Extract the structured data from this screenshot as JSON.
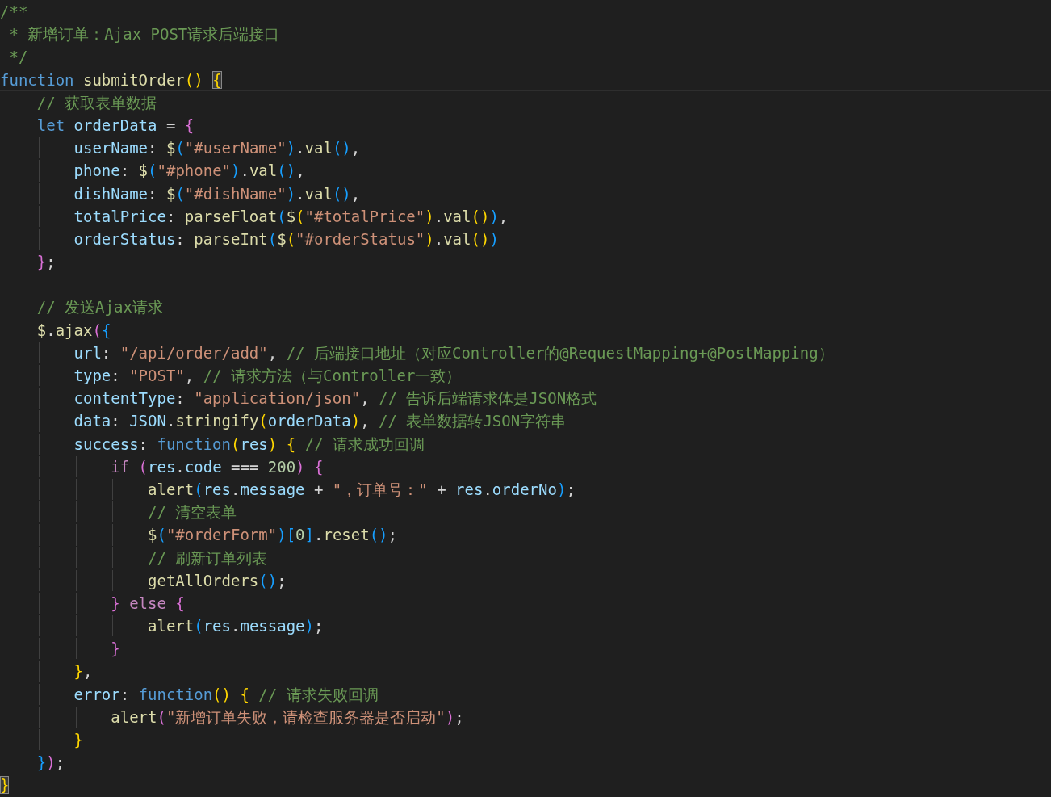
{
  "editor": {
    "lines": [
      {
        "current": false,
        "tokens": [
          {
            "text": "/**",
            "kind": "comment"
          }
        ]
      },
      {
        "current": false,
        "tokens": [
          {
            "text": " * 新增订单：Ajax POST请求后端接口",
            "kind": "comment"
          }
        ]
      },
      {
        "current": false,
        "tokens": [
          {
            "text": " */",
            "kind": "comment"
          }
        ]
      },
      {
        "current": true,
        "tokens": [
          {
            "text": "function ",
            "kind": "keyword"
          },
          {
            "text": "submitOrder",
            "kind": "function"
          },
          {
            "text": "() ",
            "kind": "bracket1"
          },
          {
            "text": "{",
            "kind": "bracket1",
            "match": true
          }
        ],
        "children": [
          {
            "current": false,
            "tokens": [
              {
                "text": "// 获取表单数据",
                "kind": "comment"
              }
            ]
          },
          {
            "current": false,
            "tokens": [
              {
                "text": "let ",
                "kind": "keyword"
              },
              {
                "text": "orderData",
                "kind": "variable"
              },
              {
                "text": " = ",
                "kind": "punctuation"
              },
              {
                "text": "{",
                "kind": "bracket2"
              }
            ],
            "children": [
              {
                "current": false,
                "tokens": [
                  {
                    "text": "userName",
                    "kind": "variable"
                  },
                  {
                    "text": ": ",
                    "kind": "punctuation"
                  },
                  {
                    "text": "$",
                    "kind": "function"
                  },
                  {
                    "text": "(",
                    "kind": "bracket3"
                  },
                  {
                    "text": "\"#userName\"",
                    "kind": "string"
                  },
                  {
                    "text": ")",
                    "kind": "bracket3"
                  },
                  {
                    "text": ".",
                    "kind": "punctuation"
                  },
                  {
                    "text": "val",
                    "kind": "function"
                  },
                  {
                    "text": "()",
                    "kind": "bracket3"
                  },
                  {
                    "text": ",",
                    "kind": "punctuation"
                  }
                ]
              },
              {
                "current": false,
                "tokens": [
                  {
                    "text": "phone",
                    "kind": "variable"
                  },
                  {
                    "text": ": ",
                    "kind": "punctuation"
                  },
                  {
                    "text": "$",
                    "kind": "function"
                  },
                  {
                    "text": "(",
                    "kind": "bracket3"
                  },
                  {
                    "text": "\"#phone\"",
                    "kind": "string"
                  },
                  {
                    "text": ")",
                    "kind": "bracket3"
                  },
                  {
                    "text": ".",
                    "kind": "punctuation"
                  },
                  {
                    "text": "val",
                    "kind": "function"
                  },
                  {
                    "text": "()",
                    "kind": "bracket3"
                  },
                  {
                    "text": ",",
                    "kind": "punctuation"
                  }
                ]
              },
              {
                "current": false,
                "tokens": [
                  {
                    "text": "dishName",
                    "kind": "variable"
                  },
                  {
                    "text": ": ",
                    "kind": "punctuation"
                  },
                  {
                    "text": "$",
                    "kind": "function"
                  },
                  {
                    "text": "(",
                    "kind": "bracket3"
                  },
                  {
                    "text": "\"#dishName\"",
                    "kind": "string"
                  },
                  {
                    "text": ")",
                    "kind": "bracket3"
                  },
                  {
                    "text": ".",
                    "kind": "punctuation"
                  },
                  {
                    "text": "val",
                    "kind": "function"
                  },
                  {
                    "text": "()",
                    "kind": "bracket3"
                  },
                  {
                    "text": ",",
                    "kind": "punctuation"
                  }
                ]
              },
              {
                "current": false,
                "tokens": [
                  {
                    "text": "totalPrice",
                    "kind": "variable"
                  },
                  {
                    "text": ": ",
                    "kind": "punctuation"
                  },
                  {
                    "text": "parseFloat",
                    "kind": "function"
                  },
                  {
                    "text": "(",
                    "kind": "bracket3"
                  },
                  {
                    "text": "$",
                    "kind": "function"
                  },
                  {
                    "text": "(",
                    "kind": "bracket1"
                  },
                  {
                    "text": "\"#totalPrice\"",
                    "kind": "string"
                  },
                  {
                    "text": ")",
                    "kind": "bracket1"
                  },
                  {
                    "text": ".",
                    "kind": "punctuation"
                  },
                  {
                    "text": "val",
                    "kind": "function"
                  },
                  {
                    "text": "()",
                    "kind": "bracket1"
                  },
                  {
                    "text": ")",
                    "kind": "bracket3"
                  },
                  {
                    "text": ",",
                    "kind": "punctuation"
                  }
                ]
              },
              {
                "current": false,
                "tokens": [
                  {
                    "text": "orderStatus",
                    "kind": "variable"
                  },
                  {
                    "text": ": ",
                    "kind": "punctuation"
                  },
                  {
                    "text": "parseInt",
                    "kind": "function"
                  },
                  {
                    "text": "(",
                    "kind": "bracket3"
                  },
                  {
                    "text": "$",
                    "kind": "function"
                  },
                  {
                    "text": "(",
                    "kind": "bracket1"
                  },
                  {
                    "text": "\"#orderStatus\"",
                    "kind": "string"
                  },
                  {
                    "text": ")",
                    "kind": "bracket1"
                  },
                  {
                    "text": ".",
                    "kind": "punctuation"
                  },
                  {
                    "text": "val",
                    "kind": "function"
                  },
                  {
                    "text": "()",
                    "kind": "bracket1"
                  },
                  {
                    "text": ")",
                    "kind": "bracket3"
                  }
                ]
              }
            ]
          },
          {
            "current": false,
            "tokens": [
              {
                "text": "}",
                "kind": "bracket2"
              },
              {
                "text": ";",
                "kind": "punctuation"
              }
            ]
          },
          {
            "current": false
          },
          {
            "current": false,
            "tokens": [
              {
                "text": "// 发送Ajax请求",
                "kind": "comment"
              }
            ]
          },
          {
            "current": false,
            "tokens": [
              {
                "text": "$",
                "kind": "function"
              },
              {
                "text": ".",
                "kind": "punctuation"
              },
              {
                "text": "ajax",
                "kind": "function"
              },
              {
                "text": "(",
                "kind": "bracket2"
              },
              {
                "text": "{",
                "kind": "bracket3"
              }
            ],
            "children": [
              {
                "current": false,
                "tokens": [
                  {
                    "text": "url",
                    "kind": "variable"
                  },
                  {
                    "text": ": ",
                    "kind": "punctuation"
                  },
                  {
                    "text": "\"/api/order/add\"",
                    "kind": "string"
                  },
                  {
                    "text": ", ",
                    "kind": "punctuation"
                  },
                  {
                    "text": "// 后端接口地址（对应Controller的@RequestMapping+@PostMapping）",
                    "kind": "comment"
                  }
                ]
              },
              {
                "current": false,
                "tokens": [
                  {
                    "text": "type",
                    "kind": "variable"
                  },
                  {
                    "text": ": ",
                    "kind": "punctuation"
                  },
                  {
                    "text": "\"POST\"",
                    "kind": "string"
                  },
                  {
                    "text": ", ",
                    "kind": "punctuation"
                  },
                  {
                    "text": "// 请求方法（与Controller一致）",
                    "kind": "comment"
                  }
                ]
              },
              {
                "current": false,
                "tokens": [
                  {
                    "text": "contentType",
                    "kind": "variable"
                  },
                  {
                    "text": ": ",
                    "kind": "punctuation"
                  },
                  {
                    "text": "\"application/json\"",
                    "kind": "string"
                  },
                  {
                    "text": ", ",
                    "kind": "punctuation"
                  },
                  {
                    "text": "// 告诉后端请求体是JSON格式",
                    "kind": "comment"
                  }
                ]
              },
              {
                "current": false,
                "tokens": [
                  {
                    "text": "data",
                    "kind": "variable"
                  },
                  {
                    "text": ": ",
                    "kind": "punctuation"
                  },
                  {
                    "text": "JSON",
                    "kind": "variable"
                  },
                  {
                    "text": ".",
                    "kind": "punctuation"
                  },
                  {
                    "text": "stringify",
                    "kind": "function"
                  },
                  {
                    "text": "(",
                    "kind": "bracket1"
                  },
                  {
                    "text": "orderData",
                    "kind": "variable"
                  },
                  {
                    "text": ")",
                    "kind": "bracket1"
                  },
                  {
                    "text": ", ",
                    "kind": "punctuation"
                  },
                  {
                    "text": "// 表单数据转JSON字符串",
                    "kind": "comment"
                  }
                ]
              },
              {
                "current": false,
                "tokens": [
                  {
                    "text": "success",
                    "kind": "variable"
                  },
                  {
                    "text": ": ",
                    "kind": "punctuation"
                  },
                  {
                    "text": "function",
                    "kind": "keyword"
                  },
                  {
                    "text": "(",
                    "kind": "bracket1"
                  },
                  {
                    "text": "res",
                    "kind": "variable"
                  },
                  {
                    "text": ") {",
                    "kind": "bracket1"
                  },
                  {
                    "text": " // 请求成功回调",
                    "kind": "comment"
                  }
                ],
                "children": [
                  {
                    "current": false,
                    "tokens": [
                      {
                        "text": "if ",
                        "kind": "control"
                      },
                      {
                        "text": "(",
                        "kind": "bracket2"
                      },
                      {
                        "text": "res",
                        "kind": "variable"
                      },
                      {
                        "text": ".",
                        "kind": "punctuation"
                      },
                      {
                        "text": "code",
                        "kind": "variable"
                      },
                      {
                        "text": " === ",
                        "kind": "punctuation"
                      },
                      {
                        "text": "200",
                        "kind": "number"
                      },
                      {
                        "text": ") {",
                        "kind": "bracket2"
                      }
                    ],
                    "children": [
                      {
                        "current": false,
                        "tokens": [
                          {
                            "text": "alert",
                            "kind": "function"
                          },
                          {
                            "text": "(",
                            "kind": "bracket3"
                          },
                          {
                            "text": "res",
                            "kind": "variable"
                          },
                          {
                            "text": ".",
                            "kind": "punctuation"
                          },
                          {
                            "text": "message",
                            "kind": "variable"
                          },
                          {
                            "text": " + ",
                            "kind": "punctuation"
                          },
                          {
                            "text": "\"，订单号：\"",
                            "kind": "string"
                          },
                          {
                            "text": " + ",
                            "kind": "punctuation"
                          },
                          {
                            "text": "res",
                            "kind": "variable"
                          },
                          {
                            "text": ".",
                            "kind": "punctuation"
                          },
                          {
                            "text": "orderNo",
                            "kind": "variable"
                          },
                          {
                            "text": ")",
                            "kind": "bracket3"
                          },
                          {
                            "text": ";",
                            "kind": "punctuation"
                          }
                        ]
                      },
                      {
                        "current": false,
                        "tokens": [
                          {
                            "text": "// 清空表单",
                            "kind": "comment"
                          }
                        ]
                      },
                      {
                        "current": false,
                        "tokens": [
                          {
                            "text": "$",
                            "kind": "function"
                          },
                          {
                            "text": "(",
                            "kind": "bracket3"
                          },
                          {
                            "text": "\"#orderForm\"",
                            "kind": "string"
                          },
                          {
                            "text": ")[",
                            "kind": "bracket3"
                          },
                          {
                            "text": "0",
                            "kind": "number"
                          },
                          {
                            "text": "]",
                            "kind": "bracket3"
                          },
                          {
                            "text": ".",
                            "kind": "punctuation"
                          },
                          {
                            "text": "reset",
                            "kind": "function"
                          },
                          {
                            "text": "()",
                            "kind": "bracket3"
                          },
                          {
                            "text": ";",
                            "kind": "punctuation"
                          }
                        ]
                      },
                      {
                        "current": false,
                        "tokens": [
                          {
                            "text": "// 刷新订单列表",
                            "kind": "comment"
                          }
                        ]
                      },
                      {
                        "current": false,
                        "tokens": [
                          {
                            "text": "getAllOrders",
                            "kind": "function"
                          },
                          {
                            "text": "()",
                            "kind": "bracket3"
                          },
                          {
                            "text": ";",
                            "kind": "punctuation"
                          }
                        ]
                      }
                    ]
                  },
                  {
                    "current": false,
                    "tokens": [
                      {
                        "text": "} ",
                        "kind": "bracket2"
                      },
                      {
                        "text": "else ",
                        "kind": "control"
                      },
                      {
                        "text": "{",
                        "kind": "bracket2"
                      }
                    ],
                    "children": [
                      {
                        "current": false,
                        "tokens": [
                          {
                            "text": "alert",
                            "kind": "function"
                          },
                          {
                            "text": "(",
                            "kind": "bracket3"
                          },
                          {
                            "text": "res",
                            "kind": "variable"
                          },
                          {
                            "text": ".",
                            "kind": "punctuation"
                          },
                          {
                            "text": "message",
                            "kind": "variable"
                          },
                          {
                            "text": ")",
                            "kind": "bracket3"
                          },
                          {
                            "text": ";",
                            "kind": "punctuation"
                          }
                        ]
                      }
                    ]
                  },
                  {
                    "current": false,
                    "tokens": [
                      {
                        "text": "}",
                        "kind": "bracket2"
                      }
                    ]
                  }
                ]
              },
              {
                "current": false,
                "tokens": [
                  {
                    "text": "}",
                    "kind": "bracket1"
                  },
                  {
                    "text": ",",
                    "kind": "punctuation"
                  }
                ]
              },
              {
                "current": false,
                "tokens": [
                  {
                    "text": "error",
                    "kind": "variable"
                  },
                  {
                    "text": ": ",
                    "kind": "punctuation"
                  },
                  {
                    "text": "function",
                    "kind": "keyword"
                  },
                  {
                    "text": "() {",
                    "kind": "bracket1"
                  },
                  {
                    "text": " // 请求失败回调",
                    "kind": "comment"
                  }
                ],
                "children": [
                  {
                    "current": false,
                    "tokens": [
                      {
                        "text": "alert",
                        "kind": "function"
                      },
                      {
                        "text": "(",
                        "kind": "bracket2"
                      },
                      {
                        "text": "\"新增订单失败，请检查服务器是否启动\"",
                        "kind": "string"
                      },
                      {
                        "text": ")",
                        "kind": "bracket2"
                      },
                      {
                        "text": ";",
                        "kind": "punctuation"
                      }
                    ]
                  }
                ]
              },
              {
                "current": false,
                "tokens": [
                  {
                    "text": "}",
                    "kind": "bracket1"
                  }
                ]
              }
            ]
          },
          {
            "current": false,
            "tokens": [
              {
                "text": "}",
                "kind": "bracket3"
              },
              {
                "text": ")",
                "kind": "bracket2"
              },
              {
                "text": ";",
                "kind": "punctuation"
              }
            ]
          }
        ]
      },
      {
        "current": false,
        "tokens": [
          {
            "text": "}",
            "kind": "bracket1",
            "match": true
          }
        ]
      }
    ]
  }
}
